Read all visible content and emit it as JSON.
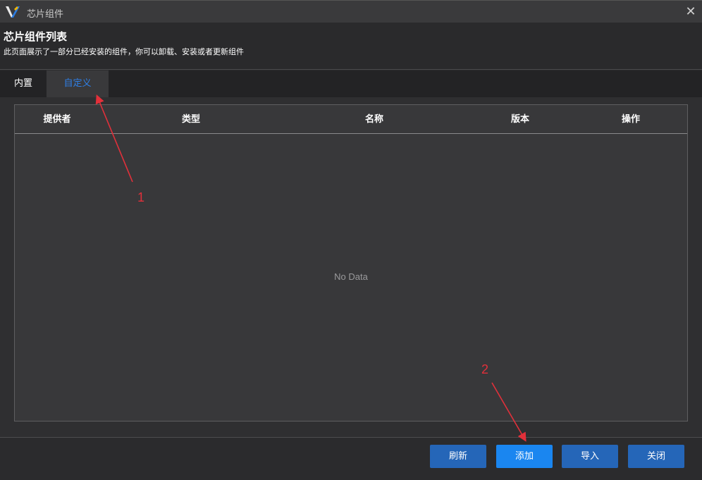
{
  "window": {
    "title": "芯片组件",
    "close_glyph": "✕",
    "icon": "app-logo-icon"
  },
  "header": {
    "title": "芯片组件列表",
    "subtitle": "此页面展示了一部分已经安装的组件，你可以卸载、安装或者更新组件"
  },
  "tabs": [
    {
      "label": "内置",
      "active": false
    },
    {
      "label": "自定义",
      "active": true
    }
  ],
  "table": {
    "columns": [
      "提供者",
      "类型",
      "名称",
      "版本",
      "操作"
    ],
    "rows": [],
    "empty_text": "No Data"
  },
  "footer": {
    "buttons": [
      "刷新",
      "添加",
      "导入",
      "关闭"
    ]
  },
  "annotations": {
    "marker_1": "1",
    "marker_2": "2",
    "color": "#e2303a"
  },
  "colors": {
    "accent": "#2f80e8",
    "primary_button": "#2566b8",
    "highlight_button": "#1a86f0"
  }
}
